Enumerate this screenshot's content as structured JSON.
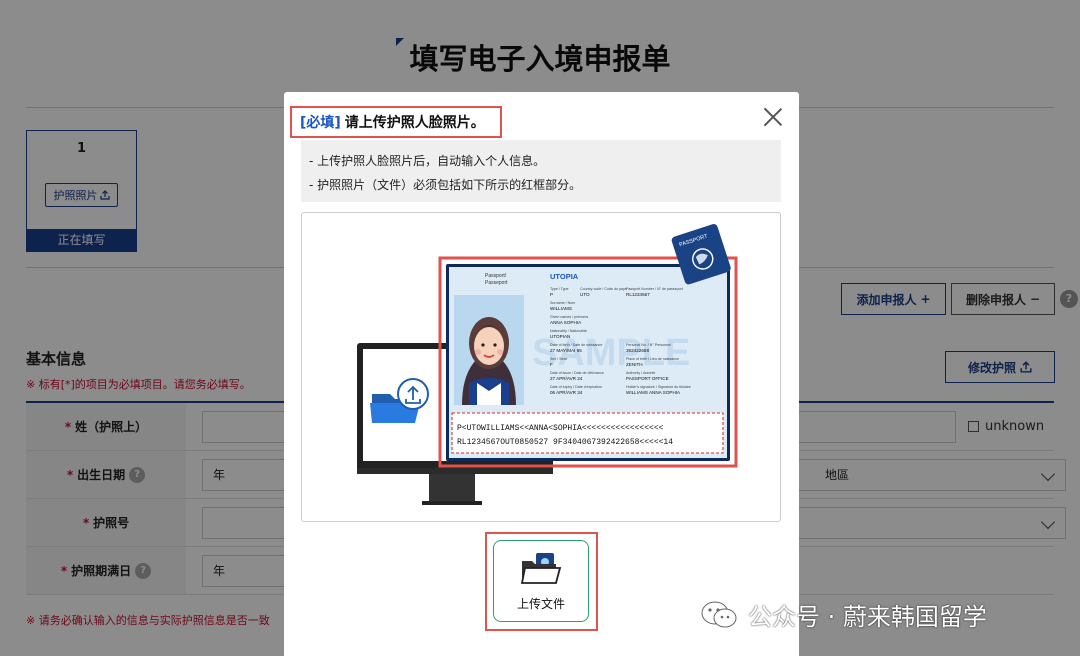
{
  "page": {
    "title": "填写电子入境申报单"
  },
  "applicant_card": {
    "number": "1",
    "passport_photo_button": "护照照片",
    "status": "正在填写"
  },
  "actions": {
    "add_applicant": "添加申报人",
    "delete_applicant": "删除申报人",
    "modify_passport": "修改护照"
  },
  "form": {
    "section_title": "基本信息",
    "required_note": "※ 标有[*]的项目为必填项目。请您务必填写。",
    "rows": [
      {
        "label": "姓（护照上）",
        "star": "*"
      },
      {
        "label": "出生日期",
        "star": "*",
        "year_placeholder": "年"
      },
      {
        "label": "护照号",
        "star": "*"
      },
      {
        "label": "护照期满日",
        "star": "*",
        "year_placeholder": "年"
      }
    ],
    "unknown_label": "unknown",
    "region_fragment": "地區",
    "confirm_note": "※ 请务必确认输入的信息与实际护照信息是否一致"
  },
  "modal": {
    "required_tag": "[必填]",
    "title": "请上传护照人脸照片。",
    "info_lines": [
      "- 上传护照人脸照片后，自动输入个人信息。",
      "- 护照照片（文件）必须包括如下所示的红框部分。"
    ],
    "upload_button": "上传文件"
  },
  "passport": {
    "doc_label_1": "Passport/",
    "doc_label_2": "Passeport",
    "country": "UTOPIA",
    "type_label": "Type / Type",
    "type_value": "P",
    "code_label": "Country code / Code du pays",
    "code_value": "UTO",
    "number_label": "Passport Number / N° de passeport",
    "number_value": "RL1234567",
    "surname_label": "Surname / Nom",
    "surname_value": "WILLIAMS",
    "given_label": "Given names / prénoms",
    "given_value": "ANNA SOPHIA",
    "nationality_label": "Nationality / Nationalité",
    "nationality_value": "UTOPIAN",
    "dob_label": "Date of birth / Date de naissance",
    "dob_value": "27 MAY/MAI 65",
    "personal_label": "Personal No. / N° Personnel",
    "personal_value": "392422658",
    "sex_label": "Sex / Sexe",
    "sex_value": "F",
    "pob_label": "Place of birth / Lieu de naissance",
    "pob_value": "ZENITH",
    "issue_label": "Date of issue / Date de délivrance",
    "issue_value": "27 APR/AVR 24",
    "authority_label": "Authority / Autorité",
    "authority_value": "PASSPORT OFFICE",
    "expiry_label": "Date of expiry / Date d'expiration",
    "expiry_value": "06 APR/AVR 34",
    "signature_label": "Holder's signature / Signature du titulaire",
    "signature_value": "WILLIAMS ANNA SOPHIA",
    "watermark": "SAMPLE",
    "mrz_line_1": "P<UTOWILLIAMS<<ANNA<SOPHIA<<<<<<<<<<<<<<<<<",
    "mrz_line_2": "RL1234567OUT0850527 9F3404067392422658<<<<<14",
    "badge_text": "PASSPORT"
  },
  "watermark": {
    "text": "公众号 · 蔚来韩国留学"
  },
  "colors": {
    "navy": "#1a3f8f",
    "red_frame": "#e0524c",
    "required_blue": "#1a56c8",
    "upload_green": "#2e9e6b",
    "note_red": "#c8102e"
  }
}
